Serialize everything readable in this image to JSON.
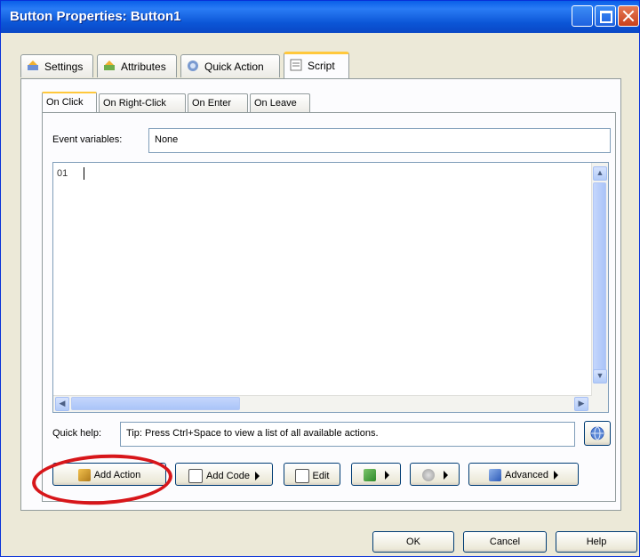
{
  "window": {
    "title": "Button Properties: Button1"
  },
  "tabs": [
    {
      "label": "Settings",
      "icon": "settings-icon",
      "active": false
    },
    {
      "label": "Attributes",
      "icon": "attributes-icon",
      "active": false
    },
    {
      "label": "Quick Action",
      "icon": "quick-action-icon",
      "active": false
    },
    {
      "label": "Script",
      "icon": "script-icon",
      "active": true
    }
  ],
  "subtabs": [
    {
      "label": "On Click",
      "active": true
    },
    {
      "label": "On Right-Click",
      "active": false
    },
    {
      "label": "On Enter",
      "active": false
    },
    {
      "label": "On Leave",
      "active": false
    }
  ],
  "event_variables": {
    "label": "Event variables:",
    "value": "None"
  },
  "editor": {
    "line_number": "01"
  },
  "quick_help": {
    "label": "Quick help:",
    "value": "Tip: Press Ctrl+Space to view a list of all available actions."
  },
  "toolbar": {
    "add_action": "Add Action",
    "add_code": "Add Code",
    "edit": "Edit",
    "advanced": "Advanced"
  },
  "dialog_buttons": {
    "ok": "OK",
    "cancel": "Cancel",
    "help": "Help"
  },
  "colors": {
    "title_bar": "#0a5fe8",
    "active_tab_accent": "#ffc83c",
    "highlight_circle": "#d7161a"
  }
}
